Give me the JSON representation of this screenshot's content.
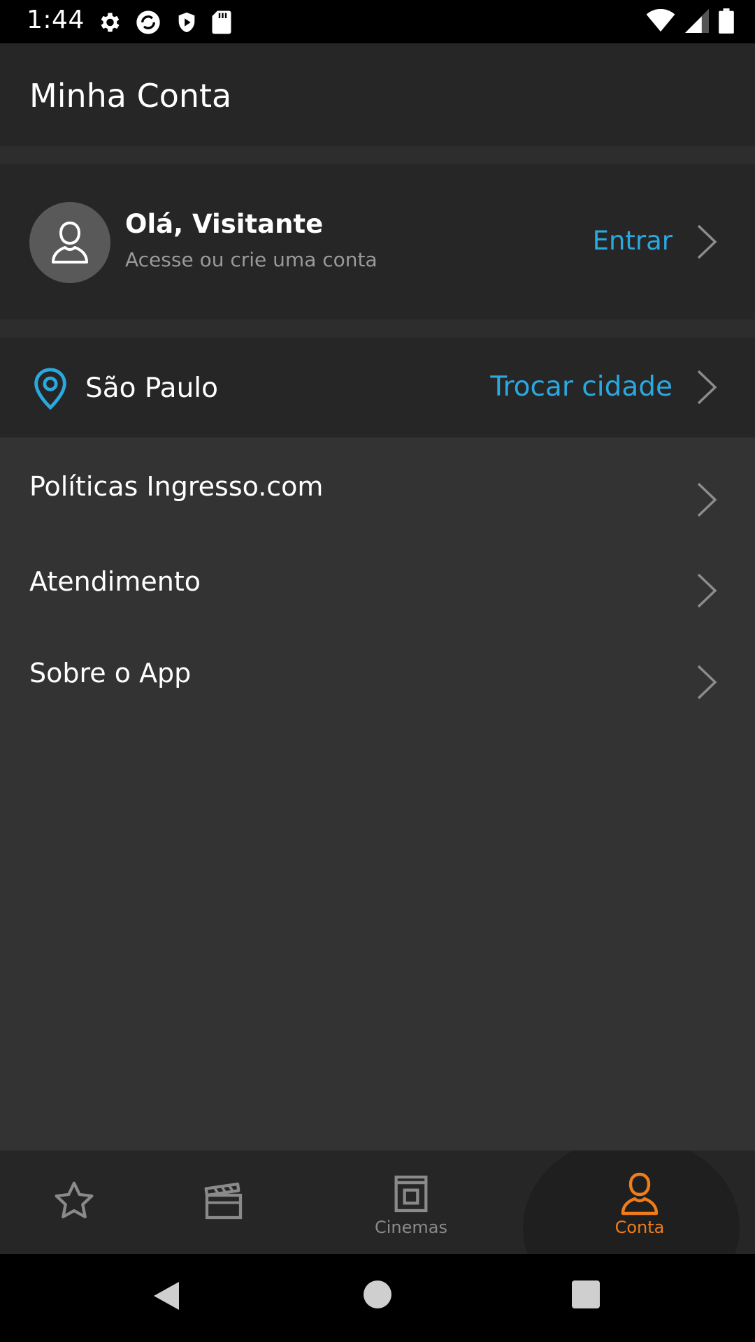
{
  "status_bar": {
    "time": "1:44"
  },
  "header": {
    "title": "Minha Conta"
  },
  "profile": {
    "greeting": "Olá, Visitante",
    "subtitle": "Acesse ou crie uma conta",
    "action": "Entrar"
  },
  "location": {
    "city": "São Paulo",
    "action": "Trocar cidade"
  },
  "menu": {
    "items": [
      {
        "label": "Políticas Ingresso.com"
      },
      {
        "label": "Atendimento"
      },
      {
        "label": "Sobre o App"
      }
    ]
  },
  "bottom_nav": {
    "items": [
      {
        "icon": "star-icon",
        "label": ""
      },
      {
        "icon": "clapperboard-icon",
        "label": ""
      },
      {
        "icon": "cinema-icon",
        "label": "Cinemas"
      },
      {
        "icon": "user-icon",
        "label": "Conta",
        "active": true
      }
    ]
  },
  "colors": {
    "accent_blue": "#2aa8e0",
    "active_orange": "#f07d1a",
    "inactive_gray": "#8a8a8a"
  }
}
